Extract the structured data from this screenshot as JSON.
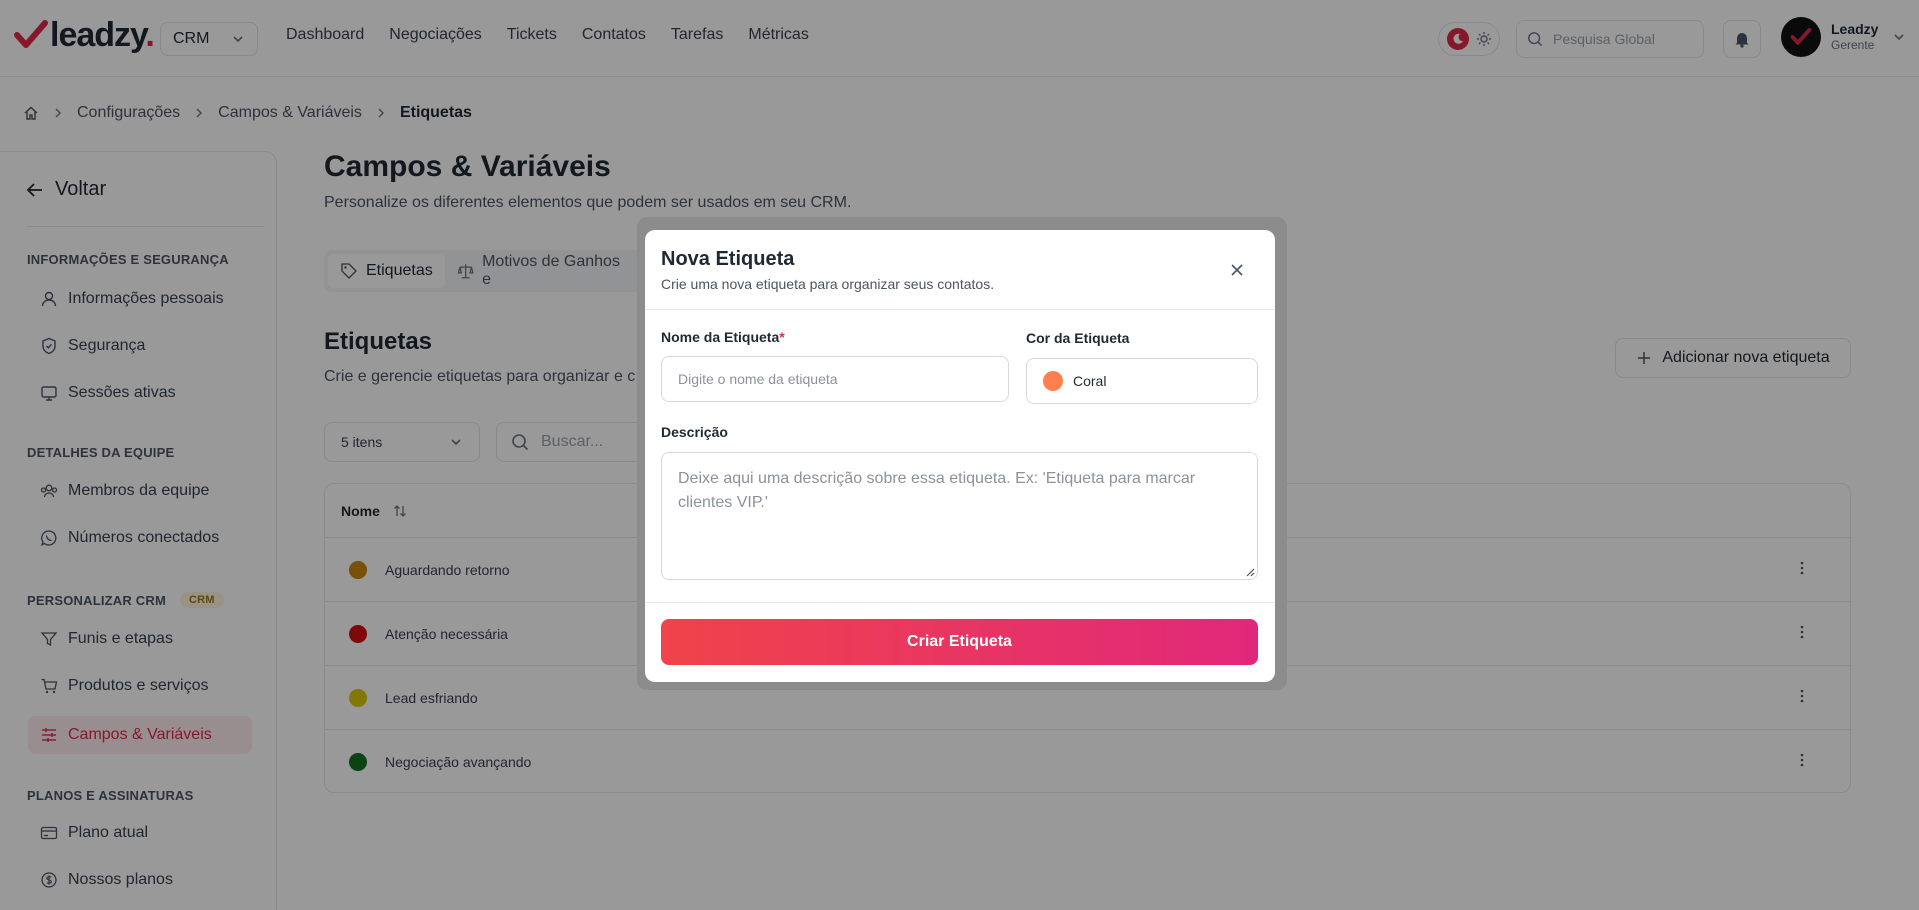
{
  "brand": {
    "name": "leadzy",
    "dot": ".",
    "accent": "#e0294a"
  },
  "topbar": {
    "module": "CRM",
    "nav": [
      "Dashboard",
      "Negociações",
      "Tickets",
      "Contatos",
      "Tarefas",
      "Métricas"
    ],
    "search_placeholder": "Pesquisa Global",
    "user": {
      "name": "Leadzy",
      "role": "Gerente"
    }
  },
  "breadcrumb": [
    "Configurações",
    "Campos & Variáveis",
    "Etiquetas"
  ],
  "sidebar": {
    "back": "Voltar",
    "sections": [
      {
        "title": "INFORMAÇÕES E SEGURANÇA",
        "items": [
          {
            "label": "Informações pessoais",
            "icon": "user-icon"
          },
          {
            "label": "Segurança",
            "icon": "shield-icon"
          },
          {
            "label": "Sessões ativas",
            "icon": "monitor-icon"
          }
        ]
      },
      {
        "title": "DETALHES DA EQUIPE",
        "items": [
          {
            "label": "Membros da equipe",
            "icon": "team-icon"
          },
          {
            "label": "Números conectados",
            "icon": "whatsapp-icon"
          }
        ]
      },
      {
        "title": "PERSONALIZAR CRM",
        "badge": "CRM",
        "items": [
          {
            "label": "Funis e etapas",
            "icon": "filter-icon"
          },
          {
            "label": "Produtos e serviços",
            "icon": "cart-icon"
          },
          {
            "label": "Campos & Variáveis",
            "icon": "sliders-icon",
            "active": true
          }
        ]
      },
      {
        "title": "PLANOS E ASSINATURAS",
        "items": [
          {
            "label": "Plano atual",
            "icon": "credit-card-icon"
          },
          {
            "label": "Nossos planos",
            "icon": "dollar-circle-icon"
          }
        ]
      }
    ]
  },
  "main": {
    "title": "Campos & Variáveis",
    "subtitle": "Personalize os diferentes elementos que podem ser usados em seu CRM.",
    "tabs": [
      "Etiquetas",
      "Motivos de Ganhos e"
    ],
    "section_title": "Etiquetas",
    "section_subtitle": "Crie e gerencie etiquetas para organizar e c",
    "add_button": "Adicionar nova etiqueta",
    "items_select": "5 itens",
    "search_placeholder": "Buscar...",
    "table": {
      "column": "Nome",
      "rows": [
        {
          "label": "Aguardando retorno",
          "color": "#c8860a"
        },
        {
          "label": "Atenção necessária",
          "color": "#d00f0f"
        },
        {
          "label": "Lead esfriando",
          "color": "#d9c90a"
        },
        {
          "label": "Negociação avançando",
          "color": "#13701f"
        }
      ]
    }
  },
  "modal": {
    "title": "Nova Etiqueta",
    "description": "Crie uma nova etiqueta para organizar seus contatos.",
    "name_label": "Nome da Etiqueta",
    "required_mark": "*",
    "name_placeholder": "Digite o nome da etiqueta",
    "color_label": "Cor da Etiqueta",
    "color_value": "Coral",
    "color_hex": "#ff7f50",
    "desc_label": "Descrição",
    "desc_placeholder": "Deixe aqui uma descrição sobre essa etiqueta. Ex: 'Etiqueta para marcar clientes VIP.'",
    "submit": "Criar Etiqueta",
    "gradient": [
      "#f0434a",
      "#e0287a"
    ]
  }
}
